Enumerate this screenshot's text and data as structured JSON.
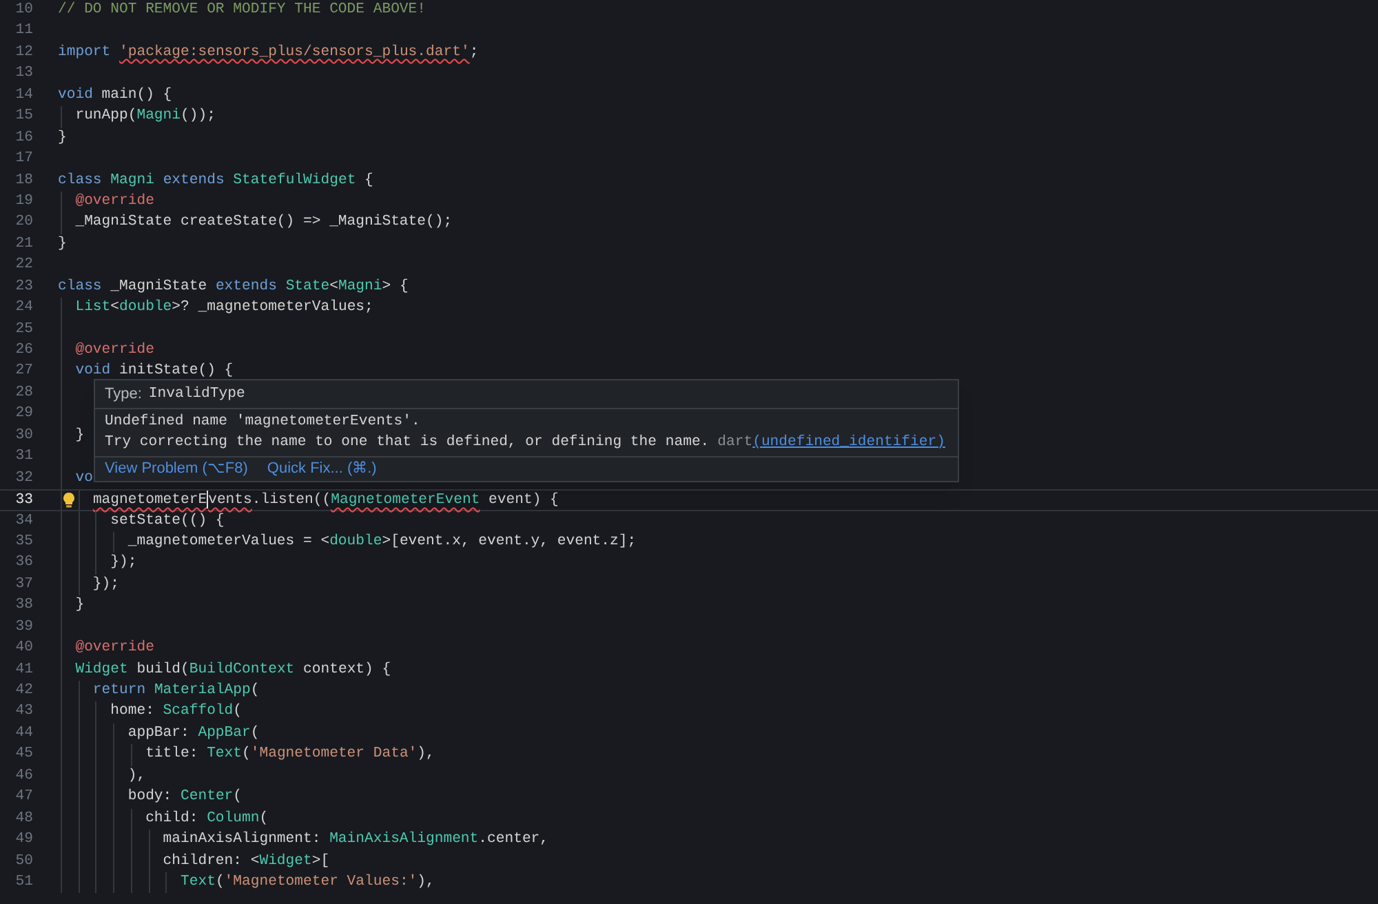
{
  "editor": {
    "lines": [
      {
        "number": "10",
        "current": false,
        "quick_fix": false,
        "tokens": [
          {
            "kind": "comment",
            "text": "// DO NOT REMOVE OR MODIFY THE CODE ABOVE!",
            "error": false
          }
        ]
      },
      {
        "number": "11",
        "current": false,
        "quick_fix": false
      },
      {
        "number": "12",
        "current": false,
        "quick_fix": false,
        "tokens": [
          {
            "kind": "keyword",
            "text": "import ",
            "error": false
          },
          {
            "kind": "string",
            "text": "'package:sensors_plus/sensors_plus.dart'",
            "error": true
          },
          {
            "kind": "plain",
            "text": ";",
            "error": false
          }
        ]
      },
      {
        "number": "13",
        "current": false,
        "quick_fix": false
      },
      {
        "number": "14",
        "current": false,
        "quick_fix": false,
        "tokens": [
          {
            "kind": "keyword",
            "text": "void",
            "error": false
          },
          {
            "kind": "plain",
            "text": " main() {",
            "error": false
          }
        ]
      },
      {
        "number": "15",
        "current": false,
        "quick_fix": false,
        "tokens": [
          {
            "kind": "plain",
            "text": "  runApp(",
            "error": false
          },
          {
            "kind": "type",
            "text": "Magni",
            "error": false
          },
          {
            "kind": "plain",
            "text": "());",
            "error": false
          }
        ]
      },
      {
        "number": "16",
        "current": false,
        "quick_fix": false,
        "tokens": [
          {
            "kind": "plain",
            "text": "}",
            "error": false
          }
        ]
      },
      {
        "number": "17",
        "current": false,
        "quick_fix": false
      },
      {
        "number": "18",
        "current": false,
        "quick_fix": false,
        "tokens": [
          {
            "kind": "keyword",
            "text": "class ",
            "error": false
          },
          {
            "kind": "type",
            "text": "Magni ",
            "error": false
          },
          {
            "kind": "keyword",
            "text": "extends ",
            "error": false
          },
          {
            "kind": "type",
            "text": "StatefulWidget",
            "error": false
          },
          {
            "kind": "plain",
            "text": " {",
            "error": false
          }
        ]
      },
      {
        "number": "19",
        "current": false,
        "quick_fix": false,
        "tokens": [
          {
            "kind": "annotation",
            "text": "  @override",
            "error": false
          }
        ]
      },
      {
        "number": "20",
        "current": false,
        "quick_fix": false,
        "tokens": [
          {
            "kind": "plain",
            "text": "  _MagniState createState() => _MagniState();",
            "error": false
          }
        ]
      },
      {
        "number": "21",
        "current": false,
        "quick_fix": false,
        "tokens": [
          {
            "kind": "plain",
            "text": "}",
            "error": false
          }
        ]
      },
      {
        "number": "22",
        "current": false,
        "quick_fix": false
      },
      {
        "number": "23",
        "current": false,
        "quick_fix": false,
        "tokens": [
          {
            "kind": "keyword",
            "text": "class",
            "error": false
          },
          {
            "kind": "plain",
            "text": " _MagniState ",
            "error": false
          },
          {
            "kind": "keyword",
            "text": "extends ",
            "error": false
          },
          {
            "kind": "type",
            "text": "State",
            "error": false
          },
          {
            "kind": "plain",
            "text": "<",
            "error": false
          },
          {
            "kind": "type",
            "text": "Magni",
            "error": false
          },
          {
            "kind": "plain",
            "text": "> {",
            "error": false
          }
        ]
      },
      {
        "number": "24",
        "current": false,
        "quick_fix": false,
        "tokens": [
          {
            "kind": "type",
            "text": "  List",
            "error": false
          },
          {
            "kind": "plain",
            "text": "<",
            "error": false
          },
          {
            "kind": "type",
            "text": "double",
            "error": false
          },
          {
            "kind": "plain",
            "text": ">? _magnetometerValues;",
            "error": false
          }
        ]
      },
      {
        "number": "25",
        "current": false,
        "quick_fix": false
      },
      {
        "number": "26",
        "current": false,
        "quick_fix": false,
        "tokens": [
          {
            "kind": "annotation",
            "text": "  @override",
            "error": false
          }
        ]
      },
      {
        "number": "27",
        "current": false,
        "quick_fix": false,
        "tokens": [
          {
            "kind": "keyword",
            "text": "  void",
            "error": false
          },
          {
            "kind": "plain",
            "text": " initState() {",
            "error": false
          }
        ]
      },
      {
        "number": "28",
        "current": false,
        "quick_fix": false
      },
      {
        "number": "29",
        "current": false,
        "quick_fix": false
      },
      {
        "number": "30",
        "current": false,
        "quick_fix": false,
        "tokens": [
          {
            "kind": "plain",
            "text": "  }",
            "error": false
          }
        ]
      },
      {
        "number": "31",
        "current": false,
        "quick_fix": false
      },
      {
        "number": "32",
        "current": false,
        "quick_fix": false,
        "tokens": [
          {
            "kind": "keyword",
            "text": "  vo",
            "error": false
          }
        ]
      },
      {
        "number": "33",
        "current": true,
        "quick_fix": true,
        "tokens": [
          {
            "kind": "plain",
            "text": "    magnetometerE",
            "error": true
          },
          {
            "kind": "caret",
            "error": false
          },
          {
            "kind": "plain",
            "text": "vents",
            "error": true
          },
          {
            "kind": "plain",
            "text": ".listen((",
            "error": false
          },
          {
            "kind": "type",
            "text": "MagnetometerEvent",
            "error": true
          },
          {
            "kind": "plain",
            "text": " event) {",
            "error": false
          }
        ]
      },
      {
        "number": "34",
        "current": false,
        "quick_fix": false,
        "tokens": [
          {
            "kind": "plain",
            "text": "      setState(() {",
            "error": false
          }
        ]
      },
      {
        "number": "35",
        "current": false,
        "quick_fix": false,
        "tokens": [
          {
            "kind": "plain",
            "text": "        _magnetometerValues = <",
            "error": false
          },
          {
            "kind": "type",
            "text": "double",
            "error": false
          },
          {
            "kind": "plain",
            "text": ">[event.x, event.y, event.z];",
            "error": false
          }
        ]
      },
      {
        "number": "36",
        "current": false,
        "quick_fix": false,
        "tokens": [
          {
            "kind": "plain",
            "text": "      });",
            "error": false
          }
        ]
      },
      {
        "number": "37",
        "current": false,
        "quick_fix": false,
        "tokens": [
          {
            "kind": "plain",
            "text": "    });",
            "error": false
          }
        ]
      },
      {
        "number": "38",
        "current": false,
        "quick_fix": false,
        "tokens": [
          {
            "kind": "plain",
            "text": "  }",
            "error": false
          }
        ]
      },
      {
        "number": "39",
        "current": false,
        "quick_fix": false
      },
      {
        "number": "40",
        "current": false,
        "quick_fix": false,
        "tokens": [
          {
            "kind": "annotation",
            "text": "  @override",
            "error": false
          }
        ]
      },
      {
        "number": "41",
        "current": false,
        "quick_fix": false,
        "tokens": [
          {
            "kind": "type",
            "text": "  Widget",
            "error": false
          },
          {
            "kind": "plain",
            "text": " build(",
            "error": false
          },
          {
            "kind": "type",
            "text": "BuildContext",
            "error": false
          },
          {
            "kind": "plain",
            "text": " context) {",
            "error": false
          }
        ]
      },
      {
        "number": "42",
        "current": false,
        "quick_fix": false,
        "tokens": [
          {
            "kind": "keyword",
            "text": "    return ",
            "error": false
          },
          {
            "kind": "type",
            "text": "MaterialApp",
            "error": false
          },
          {
            "kind": "plain",
            "text": "(",
            "error": false
          }
        ]
      },
      {
        "number": "43",
        "current": false,
        "quick_fix": false,
        "tokens": [
          {
            "kind": "plain",
            "text": "      home: ",
            "error": false
          },
          {
            "kind": "type",
            "text": "Scaffold",
            "error": false
          },
          {
            "kind": "plain",
            "text": "(",
            "error": false
          }
        ]
      },
      {
        "number": "44",
        "current": false,
        "quick_fix": false,
        "tokens": [
          {
            "kind": "plain",
            "text": "        appBar: ",
            "error": false
          },
          {
            "kind": "type",
            "text": "AppBar",
            "error": false
          },
          {
            "kind": "plain",
            "text": "(",
            "error": false
          }
        ]
      },
      {
        "number": "45",
        "current": false,
        "quick_fix": false,
        "tokens": [
          {
            "kind": "plain",
            "text": "          title: ",
            "error": false
          },
          {
            "kind": "type",
            "text": "Text",
            "error": false
          },
          {
            "kind": "plain",
            "text": "(",
            "error": false
          },
          {
            "kind": "string",
            "text": "'Magnetometer Data'",
            "error": false
          },
          {
            "kind": "plain",
            "text": "),",
            "error": false
          }
        ]
      },
      {
        "number": "46",
        "current": false,
        "quick_fix": false,
        "tokens": [
          {
            "kind": "plain",
            "text": "        ),",
            "error": false
          }
        ]
      },
      {
        "number": "47",
        "current": false,
        "quick_fix": false,
        "tokens": [
          {
            "kind": "plain",
            "text": "        body: ",
            "error": false
          },
          {
            "kind": "type",
            "text": "Center",
            "error": false
          },
          {
            "kind": "plain",
            "text": "(",
            "error": false
          }
        ]
      },
      {
        "number": "48",
        "current": false,
        "quick_fix": false,
        "tokens": [
          {
            "kind": "plain",
            "text": "          child: ",
            "error": false
          },
          {
            "kind": "type",
            "text": "Column",
            "error": false
          },
          {
            "kind": "plain",
            "text": "(",
            "error": false
          }
        ]
      },
      {
        "number": "49",
        "current": false,
        "quick_fix": false,
        "tokens": [
          {
            "kind": "plain",
            "text": "            mainAxisAlignment: ",
            "error": false
          },
          {
            "kind": "type",
            "text": "MainAxisAlignment",
            "error": false
          },
          {
            "kind": "plain",
            "text": ".center,",
            "error": false
          }
        ]
      },
      {
        "number": "50",
        "current": false,
        "quick_fix": false,
        "tokens": [
          {
            "kind": "plain",
            "text": "            children: <",
            "error": false
          },
          {
            "kind": "type",
            "text": "Widget",
            "error": false
          },
          {
            "kind": "plain",
            "text": ">[",
            "error": false
          }
        ]
      },
      {
        "number": "51",
        "current": false,
        "quick_fix": false,
        "tokens": [
          {
            "kind": "type",
            "text": "              Text",
            "error": false
          },
          {
            "kind": "plain",
            "text": "(",
            "error": false
          },
          {
            "kind": "string",
            "text": "'Magnetometer Values:'",
            "error": false
          },
          {
            "kind": "plain",
            "text": "),",
            "error": false
          }
        ]
      }
    ]
  },
  "hover": {
    "type_label": "Type:",
    "type_value": "InvalidType",
    "message": [
      "Undefined name 'magnetometerEvents'.",
      "Try correcting the name to one that is defined, or defining the name."
    ],
    "source": "dart",
    "code": "(undefined_identifier)",
    "actions": [
      "View Problem (⌥F8)",
      "Quick Fix... (⌘.)"
    ]
  }
}
